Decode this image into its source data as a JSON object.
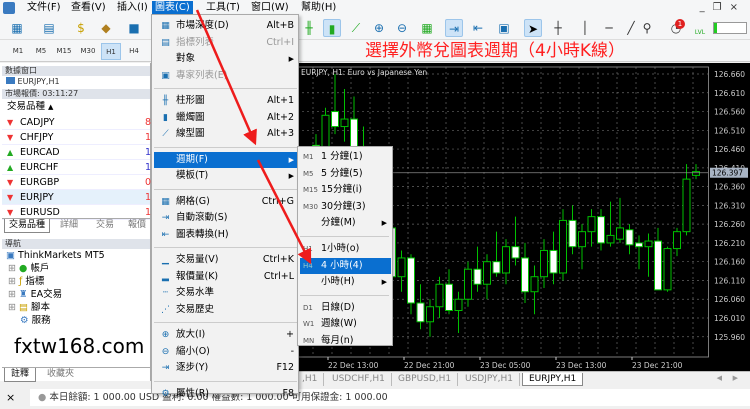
{
  "menubar": {
    "items": [
      "文件(F)",
      "查看(V)",
      "插入(I)",
      "圖表(C)",
      "工具(T)",
      "窗口(W)",
      "幫助(H)"
    ],
    "active": 3
  },
  "timeframes": [
    "M1",
    "M5",
    "M15",
    "M30",
    "H1",
    "H4"
  ],
  "timeframe_active": "H1",
  "headline": "選擇外幣兌圖表週期（4小時K線）",
  "data_window": {
    "title": "數據窗口",
    "item": "EURJPY,H1"
  },
  "market_watch": {
    "title": "市場報價: 03:11:27",
    "column": "交易品種",
    "sort": "▲",
    "rows": [
      {
        "symbol": "CADJPY",
        "dir": "down",
        "val": "8"
      },
      {
        "symbol": "CHFJPY",
        "dir": "down",
        "val": "11"
      },
      {
        "symbol": "EURCAD",
        "dir": "up",
        "val": "1."
      },
      {
        "symbol": "EURCHF",
        "dir": "up",
        "val": "1."
      },
      {
        "symbol": "EURGBP",
        "dir": "down",
        "val": "0."
      },
      {
        "symbol": "EURJPY",
        "dir": "down",
        "val": "12"
      },
      {
        "symbol": "EURUSD",
        "dir": "down",
        "val": "1."
      }
    ],
    "tabs": [
      "交易品種",
      "詳細",
      "交易",
      "報價"
    ]
  },
  "navigator": {
    "title": "導航",
    "root": "ThinkMarkets MT5",
    "items": [
      "帳戶",
      "指標",
      "EA交易",
      "腳本",
      "服務"
    ],
    "tabs": [
      "註釋",
      "收藏夾"
    ]
  },
  "watermark": "fxtw168.com",
  "chart": {
    "title": "EURJPY, H1:  Euro vs Japanese Yen",
    "current_price": "126.397",
    "price_ticks": [
      "126.660",
      "126.610",
      "126.560",
      "126.510",
      "126.460",
      "126.410",
      "126.360",
      "126.310",
      "126.260",
      "126.210",
      "126.160",
      "126.110",
      "126.060",
      "126.010",
      "125.960"
    ],
    "time_labels": [
      "22 Dec 13:00",
      "22 Dec 21:00",
      "23 Dec 05:00",
      "23 Dec 13:00",
      "23 Dec 21:00"
    ],
    "candles": [
      [
        126.47,
        126.5,
        126.44,
        126.46
      ],
      [
        126.45,
        126.57,
        126.43,
        126.55
      ],
      [
        126.56,
        126.66,
        126.5,
        126.52
      ],
      [
        126.52,
        126.62,
        126.48,
        126.54
      ],
      [
        126.54,
        126.6,
        126.43,
        126.44
      ],
      [
        126.44,
        126.52,
        126.38,
        126.4
      ],
      [
        126.4,
        126.45,
        126.3,
        126.33
      ],
      [
        126.33,
        126.36,
        126.22,
        126.25
      ],
      [
        126.25,
        126.28,
        126.1,
        126.12
      ],
      [
        126.12,
        126.19,
        126.08,
        126.17
      ],
      [
        126.17,
        126.18,
        126.02,
        126.05
      ],
      [
        126.05,
        126.1,
        125.98,
        126.0
      ],
      [
        126.0,
        126.06,
        125.96,
        126.04
      ],
      [
        126.04,
        126.12,
        126.01,
        126.1
      ],
      [
        126.1,
        126.14,
        126.02,
        126.03
      ],
      [
        126.03,
        126.08,
        125.97,
        126.06
      ],
      [
        126.06,
        126.16,
        126.04,
        126.14
      ],
      [
        126.14,
        126.2,
        126.08,
        126.1
      ],
      [
        126.1,
        126.18,
        126.06,
        126.16
      ],
      [
        126.16,
        126.24,
        126.12,
        126.13
      ],
      [
        126.13,
        126.22,
        126.1,
        126.2
      ],
      [
        126.2,
        126.28,
        126.15,
        126.17
      ],
      [
        126.17,
        126.21,
        126.05,
        126.08
      ],
      [
        126.08,
        126.15,
        126.02,
        126.12
      ],
      [
        126.12,
        126.22,
        126.09,
        126.19
      ],
      [
        126.19,
        126.24,
        126.1,
        126.13
      ],
      [
        126.13,
        126.3,
        126.11,
        126.27
      ],
      [
        126.27,
        126.31,
        126.18,
        126.2
      ],
      [
        126.2,
        126.26,
        126.14,
        126.24
      ],
      [
        126.24,
        126.3,
        126.2,
        126.28
      ],
      [
        126.28,
        126.3,
        126.19,
        126.21
      ],
      [
        126.21,
        126.32,
        126.2,
        126.23
      ],
      [
        126.22,
        126.33,
        126.21,
        126.25
      ],
      [
        126.245,
        126.26,
        126.18,
        126.205
      ],
      [
        126.21,
        126.23,
        126.14,
        126.2
      ],
      [
        126.2,
        126.235,
        126.12,
        126.215
      ],
      [
        126.215,
        126.25,
        126.085,
        126.085
      ],
      [
        126.085,
        126.2,
        126.08,
        126.195
      ],
      [
        126.195,
        126.25,
        126.175,
        126.24
      ],
      [
        126.24,
        126.42,
        126.23,
        126.38
      ],
      [
        126.39,
        126.42,
        126.38,
        126.4
      ]
    ],
    "colors": {
      "bg": "#000000",
      "candle": "#00c000",
      "bear_fill": "#ffffff"
    }
  },
  "chart_tabs": [
    ",H1",
    "USDCHF,H1",
    "GBPUSD,H1",
    "USDJPY,H1",
    "EURJPY,H1"
  ],
  "status": "本日餘額: 1 000.00 USD  盈利: 0.00  權益數: 1 000.00  可用保證金: 1 000.00",
  "notification_badge": "1",
  "lvl_label": "LVL",
  "chart_menu": [
    {
      "icon": "depth",
      "label": "市場深度(D)",
      "shortcut": "Alt+B"
    },
    {
      "icon": "indicators",
      "label": "指標列表",
      "shortcut": "Ctrl+I",
      "disabled": true
    },
    {
      "label": "對象",
      "submenu": true
    },
    {
      "icon": "experts",
      "label": "專家列表(E)",
      "disabled": true
    },
    {
      "sep": true
    },
    {
      "icon": "bar-chart",
      "label": "柱形圖",
      "shortcut": "Alt+1"
    },
    {
      "icon": "candlestick",
      "label": "蠟燭圖",
      "shortcut": "Alt+2"
    },
    {
      "icon": "line-chart",
      "label": "線型圖",
      "shortcut": "Alt+3"
    },
    {
      "sep": true
    },
    {
      "label": "週期(F)",
      "submenu": true,
      "highlight": true
    },
    {
      "label": "模板(T)",
      "submenu": true
    },
    {
      "sep": true
    },
    {
      "icon": "grid",
      "label": "網格(G)",
      "shortcut": "Ctrl+G"
    },
    {
      "icon": "autoscroll",
      "label": "自動滾動(S)"
    },
    {
      "icon": "chart-shift",
      "label": "圖表轉換(H)"
    },
    {
      "sep": true
    },
    {
      "icon": "volume",
      "label": "交易量(V)",
      "shortcut": "Ctrl+K"
    },
    {
      "icon": "tick-volume",
      "label": "報價量(K)",
      "shortcut": "Ctrl+L"
    },
    {
      "icon": "trade-levels",
      "label": "交易水準"
    },
    {
      "icon": "trade-history",
      "label": "交易歷史"
    },
    {
      "sep": true
    },
    {
      "icon": "zoom-in",
      "label": "放大(I)",
      "shortcut": "+"
    },
    {
      "icon": "zoom-out",
      "label": "縮小(O)",
      "shortcut": "-"
    },
    {
      "icon": "step",
      "label": "逐步(Y)",
      "shortcut": "F12"
    },
    {
      "sep": true
    },
    {
      "icon": "properties",
      "label": "屬性(R)",
      "shortcut": "F8"
    }
  ],
  "period_menu": [
    {
      "tag": "M1",
      "label": "1 分鐘(1)"
    },
    {
      "tag": "M5",
      "label": "5 分鐘(5)"
    },
    {
      "tag": "M15",
      "label": "15分鐘(i)"
    },
    {
      "tag": "M30",
      "label": "30分鐘(3)"
    },
    {
      "label": "分鐘(M)",
      "submenu": true
    },
    {
      "sep": true
    },
    {
      "tag": "H1",
      "label": "1小時(o)"
    },
    {
      "tag": "H4",
      "label": "4 小時(4)",
      "highlight": true
    },
    {
      "label": "小時(H)",
      "submenu": true
    },
    {
      "sep": true
    },
    {
      "tag": "D1",
      "label": "日線(D)"
    },
    {
      "tag": "W1",
      "label": "週線(W)"
    },
    {
      "tag": "MN",
      "label": "每月(n)"
    }
  ]
}
